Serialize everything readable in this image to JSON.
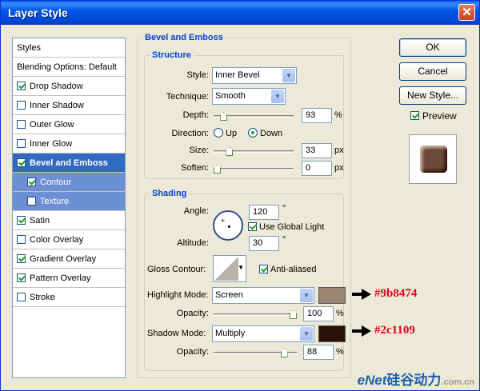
{
  "window": {
    "title": "Layer Style",
    "close_glyph": "✕"
  },
  "styles_list": {
    "items": [
      {
        "label": "Styles",
        "type": "header"
      },
      {
        "label": "Blending Options: Default",
        "type": "header"
      },
      {
        "label": "Drop Shadow",
        "checked": true
      },
      {
        "label": "Inner Shadow",
        "checked": false
      },
      {
        "label": "Outer Glow",
        "checked": false
      },
      {
        "label": "Inner Glow",
        "checked": false
      },
      {
        "label": "Bevel and Emboss",
        "checked": true,
        "selected": true
      },
      {
        "label": "Contour",
        "checked": true,
        "sub": true
      },
      {
        "label": "Texture",
        "checked": false,
        "sub": true
      },
      {
        "label": "Satin",
        "checked": true
      },
      {
        "label": "Color Overlay",
        "checked": false
      },
      {
        "label": "Gradient Overlay",
        "checked": true
      },
      {
        "label": "Pattern Overlay",
        "checked": true
      },
      {
        "label": "Stroke",
        "checked": false
      }
    ]
  },
  "bevel": {
    "group_title": "Bevel and Emboss",
    "structure": {
      "title": "Structure",
      "style_label": "Style:",
      "style_value": "Inner Bevel",
      "technique_label": "Technique:",
      "technique_value": "Smooth",
      "depth_label": "Depth:",
      "depth_value": "93",
      "depth_unit": "%",
      "depth_slider": 0.09,
      "direction_label": "Direction:",
      "direction_up": "Up",
      "direction_down": "Down",
      "direction_selected": "Down",
      "size_label": "Size:",
      "size_value": "33",
      "size_unit": "px",
      "size_slider": 0.17,
      "soften_label": "Soften:",
      "soften_value": "0",
      "soften_unit": "px",
      "soften_slider": 0.0
    },
    "shading": {
      "title": "Shading",
      "angle_label": "Angle:",
      "angle_value": "120",
      "angle_unit": "°",
      "global_light_label": "Use Global Light",
      "global_light_checked": true,
      "altitude_label": "Altitude:",
      "altitude_value": "30",
      "altitude_unit": "°",
      "gloss_label": "Gloss Contour:",
      "anti_aliased_label": "Anti-aliased",
      "anti_aliased_checked": true,
      "highlight_label": "Highlight Mode:",
      "highlight_value": "Screen",
      "highlight_color": "#9b8474",
      "highlight_opacity_label": "Opacity:",
      "highlight_opacity_value": "100",
      "highlight_opacity_unit": "%",
      "highlight_opacity_slider": 1.0,
      "shadow_label": "Shadow Mode:",
      "shadow_value": "Multiply",
      "shadow_color": "#2c1109",
      "shadow_opacity_label": "Opacity:",
      "shadow_opacity_value": "88",
      "shadow_opacity_unit": "%",
      "shadow_opacity_slider": 0.88
    }
  },
  "buttons": {
    "ok": "OK",
    "cancel": "Cancel",
    "new_style": "New Style...",
    "preview_label": "Preview",
    "preview_checked": true
  },
  "callouts": {
    "highlight_hex": "#9b8474",
    "shadow_hex": "#2c1109"
  },
  "watermark": {
    "brand": "eNet",
    "cn": "硅谷动力",
    "domain": ".com.cn"
  },
  "colors": {
    "preview_fill": "#6b4a3a",
    "preview_edge": "#c9b4a4",
    "accent": "#316ac5"
  }
}
